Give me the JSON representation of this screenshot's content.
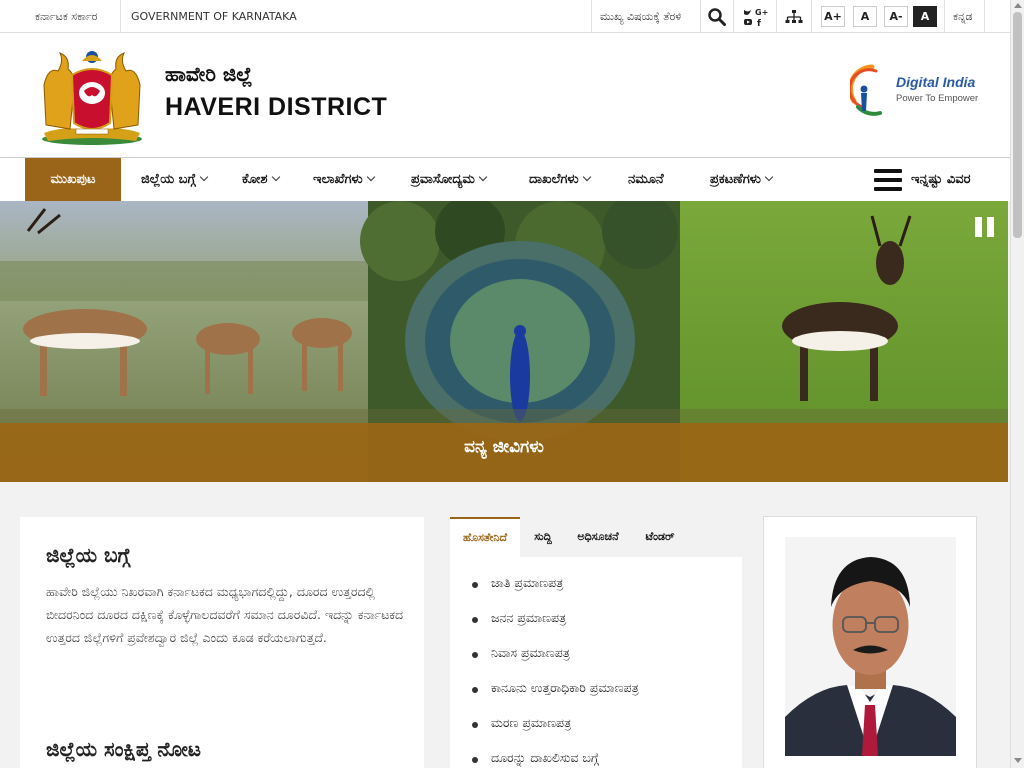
{
  "topbar": {
    "gov_kannada": "ಕರ್ನಾಟಕ ಸರ್ಕಾರ",
    "gov_english": "GOVERNMENT OF KARNATAKA",
    "skip_link": "ಮುಖ್ಯ ವಿಷಯಕ್ಕೆ ತೆರಳಿ",
    "font_increase": "A+",
    "font_normal": "A",
    "font_decrease": "A-",
    "contrast": "A",
    "language": "ಕನ್ನಡ"
  },
  "header": {
    "district_kannada": "ಹಾವೇರಿ ಜಿಲ್ಲೆ",
    "district_english": "HAVERI DISTRICT",
    "digital_india_title": "Digital India",
    "digital_india_tagline": "Power To Empower"
  },
  "nav": {
    "items": [
      {
        "label": "ಮುಖಪುಟ"
      },
      {
        "label": "ಜಿಲ್ಲೆಯ ಬಗ್ಗೆ"
      },
      {
        "label": "ಕೋಶ"
      },
      {
        "label": "ಇಲಾಖೆಗಳು"
      },
      {
        "label": "ಪ್ರವಾಸೋದ್ಯಮ"
      },
      {
        "label": "ದಾಖಲೆಗಳು"
      },
      {
        "label": "ನಮೂನೆ"
      },
      {
        "label": "ಪ್ರಕಟಣೆಗಳು"
      }
    ],
    "more_label": "ಇನ್ನಷ್ಟು ವಿವರ"
  },
  "slider": {
    "caption": "ವನ್ಯ ಜೀವಿಗಳು"
  },
  "about": {
    "title": "ಜಿಲ್ಲೆಯ ಬಗ್ಗೆ",
    "text": "ಹಾವೇರಿ ಜಿಲ್ಲೆಯು ನಿಖರವಾಗಿ ಕರ್ನಾಟಕದ ಮಧ್ಯಭಾಗದಲ್ಲಿದ್ದು, ದೂರದ ಉತ್ತರದಲ್ಲಿ ಬೀದರನಿಂದ ದೂರದ ದಕ್ಷಿಣಕ್ಕೆ ಕೊಳ್ಳೆಗಾಲದವರೆಗೆ ಸಮಾನ ದೂರವಿದೆ. ಇದನ್ನು ಕರ್ನಾಟಕದ ಉತ್ತರದ ಜಿಲ್ಲೆಗಳಿಗೆ ಪ್ರವೇಶದ್ವಾರ ಜಿಲ್ಲೆ ಎಂದು ಕೂಡ ಕರೆಯಲಾಗುತ್ತದೆ.",
    "overview_title": "ಜಿಲ್ಲೆಯ ಸಂಕ್ಷಿಪ್ತ ನೋಟ"
  },
  "services": {
    "tabs": [
      {
        "label": "ಹೊಸತೇನಿದೆ"
      },
      {
        "label": "ಸುದ್ದಿ"
      },
      {
        "label": "ಅಧಿಸೂಚನೆ"
      },
      {
        "label": "ಟೆಂಡರ್"
      }
    ],
    "items": [
      "ಜಾತಿ ಪ್ರಮಾಣಪತ್ರ",
      "ಜನನ ಪ್ರಮಾಣಪತ್ರ",
      "ನಿವಾಸ ಪ್ರಮಾಣಪತ್ರ",
      "ಕಾನೂನು ಉತ್ತರಾಧಿಕಾರಿ ಪ್ರಮಾಣಪತ್ರ",
      "ಮರಣ ಪ್ರಮಾಣಪತ್ರ",
      "ದೂರನ್ನು ದಾಖಲಿಸುವ ಬಗ್ಗೆ"
    ]
  }
}
